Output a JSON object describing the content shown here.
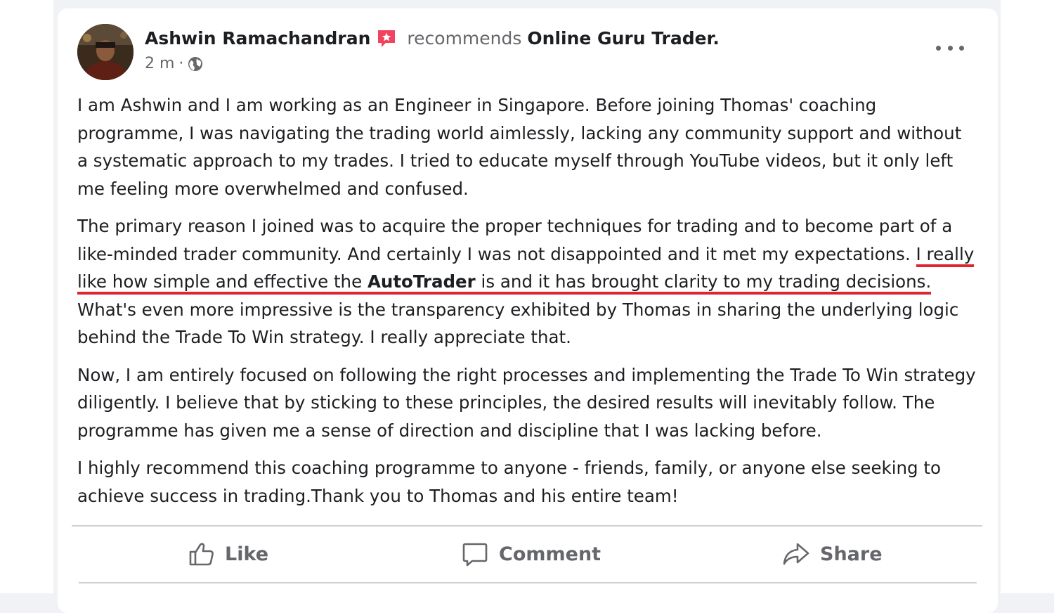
{
  "post": {
    "author": "Ashwin Ramachandran",
    "verb": "recommends",
    "page_name": "Online Guru Trader.",
    "time": "2 m",
    "separator": "·",
    "paragraphs": {
      "p1": "I am Ashwin and I am working as an Engineer in Singapore. Before joining Thomas' coaching programme, I was navigating the trading world aimlessly, lacking any community support and without a systematic approach to my trades. I tried to educate myself through YouTube videos, but it only left me feeling more overwhelmed and confused.",
      "p2_before": "The primary reason I joined was to acquire the proper techniques for trading and to become part of a like-minded trader community. And certainly I was not disappointed and it met my expectations. ",
      "p2_hl_a": "I really like how simple and effective the ",
      "p2_hl_brand": "AutoTrader",
      "p2_hl_b": " is and it has brought clarity to my trading decisions.",
      "p2_after": " What's even more impressive is the transparency exhibited by Thomas in sharing the underlying logic behind the Trade To Win strategy. I really appreciate that.",
      "p3": "Now, I am entirely focused on following the right processes and implementing the Trade To Win strategy diligently. I believe that by sticking to these principles, the desired results will inevitably follow. The programme has given me a sense of direction and discipline that I was lacking before.",
      "p4": "I highly recommend this coaching programme to anyone - friends, family, or anyone else seeking to achieve success in trading.Thank you to Thomas and his entire team!"
    },
    "highlight_color": "#e0242b",
    "icons": [
      "avatar",
      "recommend-icon",
      "globe-icon",
      "more-options-icon",
      "like-icon",
      "comment-icon",
      "share-icon"
    ]
  },
  "actions": {
    "like": "Like",
    "comment": "Comment",
    "share": "Share"
  },
  "colors": {
    "recommend_badge": "#f3425f",
    "secondary_text": "#65676b"
  }
}
